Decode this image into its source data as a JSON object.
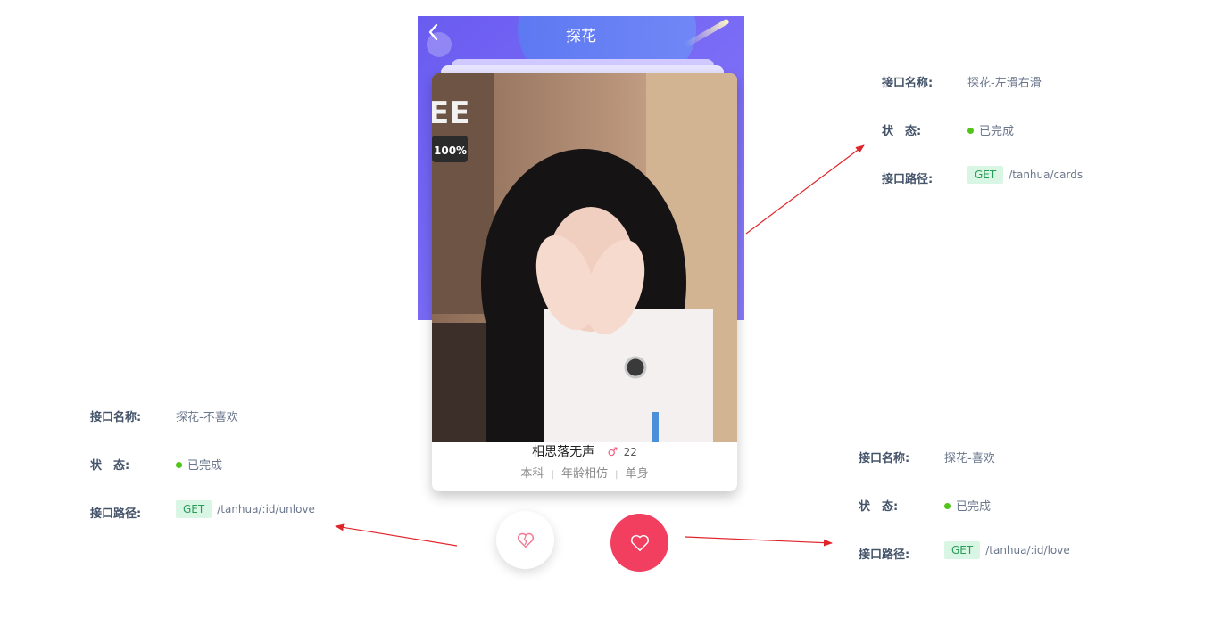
{
  "app": {
    "title": "探花"
  },
  "card": {
    "name": "相思落无声",
    "gender_icon": "female-icon",
    "age": "22",
    "tags": [
      "本科",
      "年龄相仿",
      "单身"
    ],
    "separator": "|"
  },
  "actions": {
    "dislike_icon": "broken-heart-icon",
    "like_icon": "heart-icon"
  },
  "annotations": [
    {
      "name_label": "接口名称:",
      "name_value": "探花-左滑右滑",
      "status_label": "状　态:",
      "status_value": "已完成",
      "path_label": "接口路径:",
      "method": "GET",
      "path": "/tanhua/cards"
    },
    {
      "name_label": "接口名称:",
      "name_value": "探花-不喜欢",
      "status_label": "状　态:",
      "status_value": "已完成",
      "path_label": "接口路径:",
      "method": "GET",
      "path": "/tanhua/:id/unlove"
    },
    {
      "name_label": "接口名称:",
      "name_value": "探花-喜欢",
      "status_label": "状　态:",
      "status_value": "已完成",
      "path_label": "接口路径:",
      "method": "GET",
      "path": "/tanhua/:id/love"
    }
  ],
  "colors": {
    "header_gradient_start": "#6a5cf0",
    "like_button": "#f23f5f",
    "status_done": "#52c41a",
    "method_bg": "#d9f5e3",
    "arrow": "#e0242a"
  }
}
